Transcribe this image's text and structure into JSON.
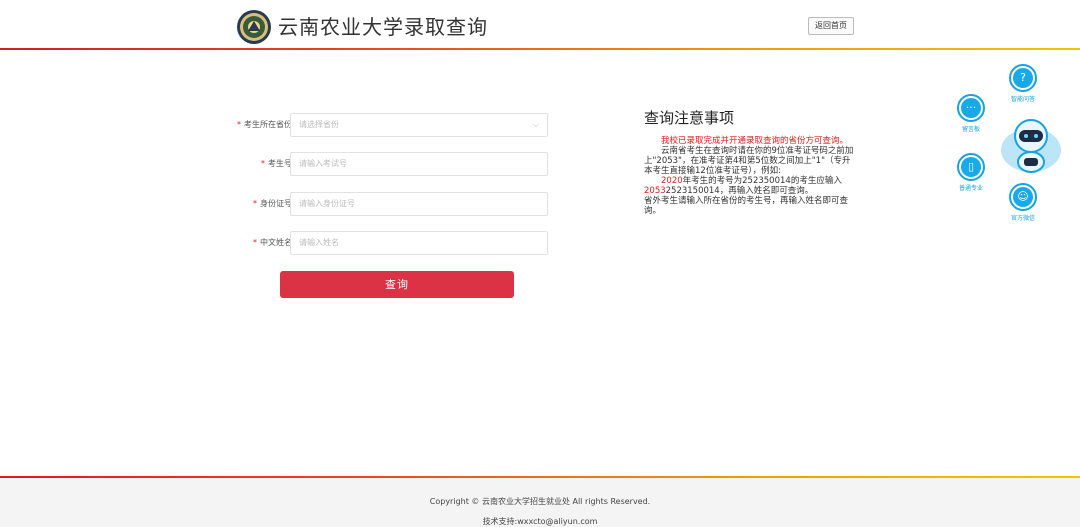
{
  "header": {
    "title": "云南农业大学录取查询",
    "home_button": "返回首页"
  },
  "form": {
    "fields": [
      {
        "label": "考生所在省份",
        "placeholder": "请选择省份",
        "type": "select"
      },
      {
        "label": "考生号",
        "placeholder": "请输入考试号",
        "type": "text"
      },
      {
        "label": "身份证号",
        "placeholder": "请输入身份证号",
        "type": "text"
      },
      {
        "label": "中文姓名",
        "placeholder": "请输入姓名",
        "type": "text"
      }
    ],
    "required_mark": "*",
    "submit_label": "查询"
  },
  "notice": {
    "title": "查询注意事项",
    "p1_red": "我校已录取完成并开通录取查询的省份方可查询。",
    "p2": "云南省考生在查询时请在你的9位准考证号码之前加上\"2053\"，在准考证第4和第5位数之间加上\"1\"（专升本考生直接输12位准考证号），例如:",
    "p3_red_a": "2020",
    "p3_a": "年考生的考号为252350014的考生应输入",
    "p3_red_b": "2053",
    "p3_b": "2523150014，再输入姓名即可查询。",
    "p4": "省外考生请输入所在省份的考生号，再输入姓名即可查询。"
  },
  "float_bar": {
    "items": [
      {
        "label": "智能问答",
        "icon": "question-icon"
      },
      {
        "label": "留言板",
        "icon": "chat-dots-icon"
      },
      {
        "label": "普通专业",
        "icon": "book-icon"
      },
      {
        "label": "官方微信",
        "icon": "wechat-icon"
      }
    ]
  },
  "footer": {
    "copyright": "Copyright © 云南农业大学招生就业处 All rights Reserved.",
    "tech_support": "技术支持:wxxcto@aliyun.com"
  },
  "colors": {
    "accent": "#dc3246",
    "float_blue": "#16a3e0",
    "required_red": "#e02020"
  }
}
